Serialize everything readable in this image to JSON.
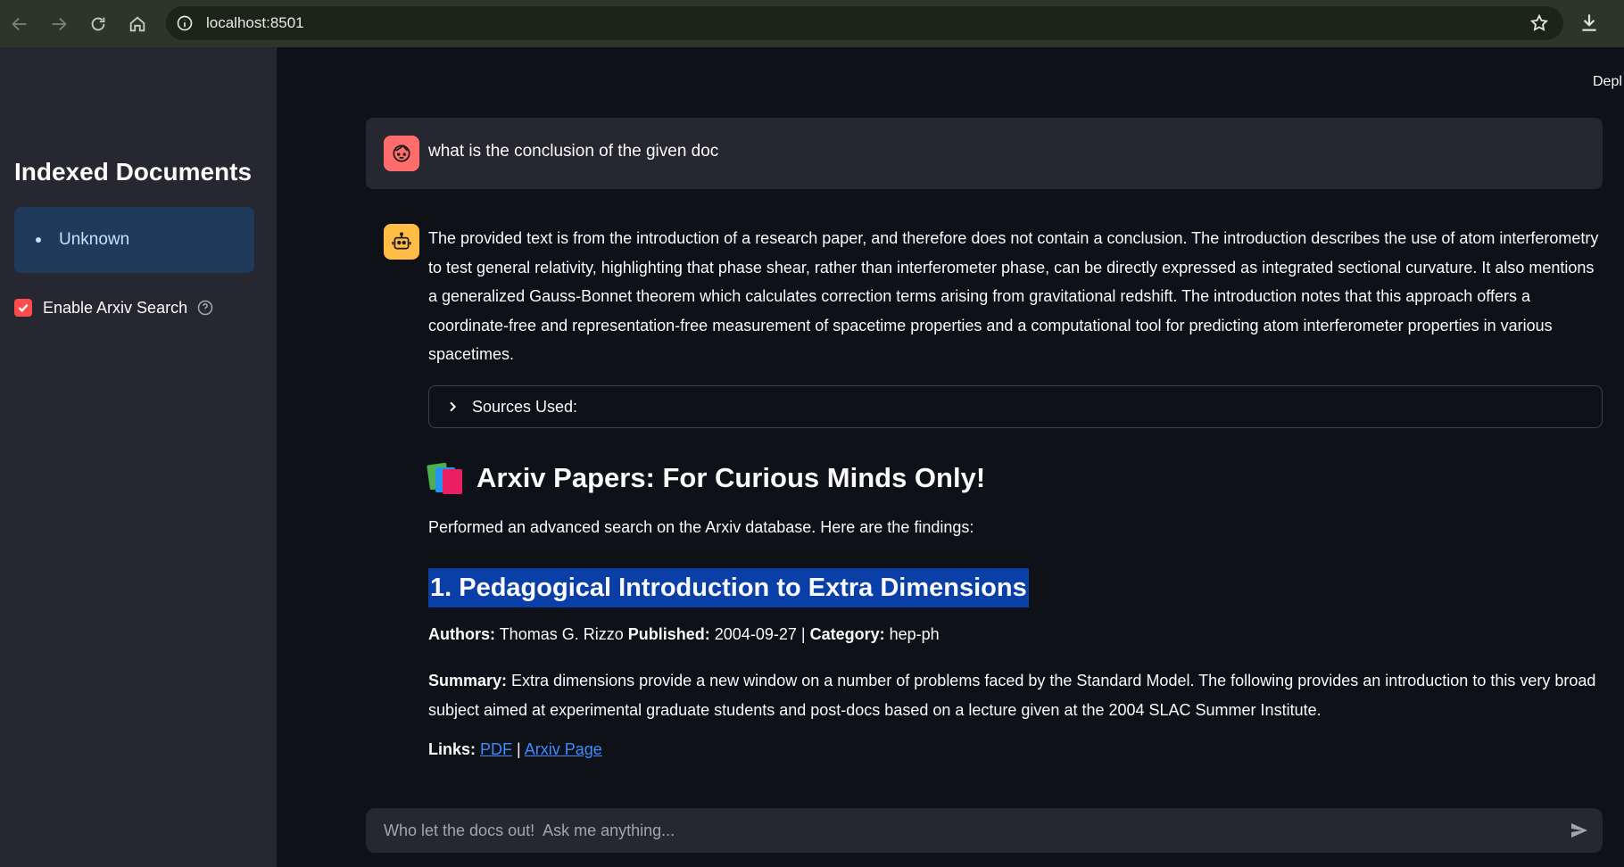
{
  "browser": {
    "url": "localhost:8501"
  },
  "sidebar": {
    "title": "Indexed Documents",
    "documents": [
      "Unknown"
    ],
    "checkbox_label": "Enable Arxiv Search",
    "checkbox_checked": true
  },
  "main": {
    "deploy_label": "Depl",
    "user_message": "what is the conclusion of the given doc",
    "answer": "The provided text is from the introduction of a research paper, and therefore does not contain a conclusion. The introduction describes the use of atom interferometry to test general relativity, highlighting that phase shear, rather than interferometer phase, can be directly expressed as integrated sectional curvature. It also mentions a generalized Gauss-Bonnet theorem which calculates correction terms arising from gravitational redshift. The introduction notes that this approach offers a coordinate-free and representation-free measurement of spacetime properties and a computational tool for predicting atom interferometer properties in various spacetimes.",
    "sources_label": "Sources Used:",
    "arxiv_heading": "Arxiv Papers: For Curious Minds Only!",
    "arxiv_intro": "Performed an advanced search on the Arxiv database. Here are the findings:",
    "paper": {
      "title": "1. Pedagogical Introduction to Extra Dimensions",
      "authors_label": "Authors:",
      "authors": "Thomas G. Rizzo",
      "published_label": "Published:",
      "published": "2004-09-27",
      "separator": "|",
      "category_label": "Category:",
      "category": "hep-ph",
      "summary_label": "Summary:",
      "summary": "Extra dimensions provide a new window on a number of problems faced by the Standard Model. The following provides an introduction to this very broad subject aimed at experimental graduate students and post-docs based on a lecture given at the 2004 SLAC Summer Institute.",
      "links_label": "Links:",
      "link_pdf": "PDF",
      "link_separator": "|",
      "link_page": "Arxiv Page"
    },
    "chat_placeholder": "Who let the docs out!  Ask me anything..."
  },
  "colors": {
    "accent": "#ff4b4b",
    "link": "#3c8cff",
    "highlight": "#0b3fa8",
    "user_avatar": "#ff6c6c",
    "bot_avatar": "#ffbd45"
  },
  "icons": {
    "back": "arrow-left-icon",
    "forward": "arrow-right-icon",
    "reload": "reload-icon",
    "home": "home-icon",
    "site_info": "info-icon",
    "bookmark": "star-icon",
    "download": "download-icon",
    "user_avatar": "user-face-icon",
    "bot_avatar": "robot-icon",
    "heading": "books-icon",
    "send": "send-icon"
  }
}
